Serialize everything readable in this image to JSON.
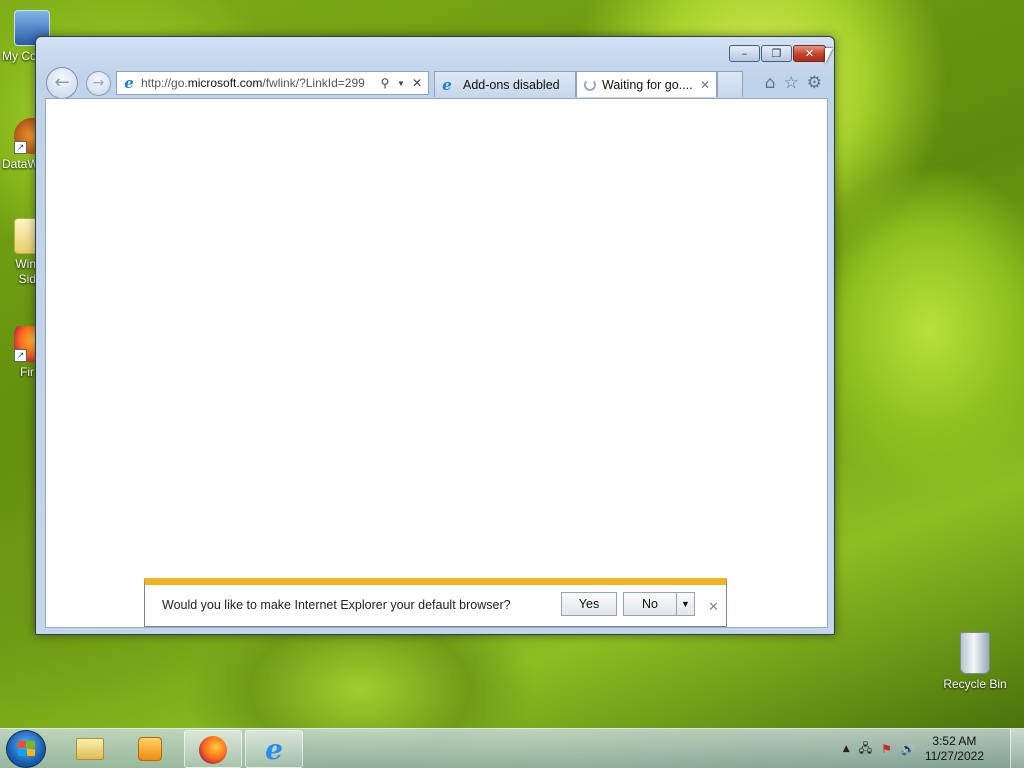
{
  "desktop": {
    "icons": [
      {
        "label": "My Co"
      },
      {
        "label": "DataW"
      },
      {
        "label": "Win\nSid"
      },
      {
        "label": "Fir"
      },
      {
        "label": "Recycle Bin"
      }
    ]
  },
  "browser": {
    "caption": {
      "minimize": "–",
      "restore": "❐",
      "close": "✕"
    },
    "address": {
      "prefix": "http://go.",
      "domain": "microsoft.com",
      "suffix": "/fwlink/?LinkId=299"
    },
    "tabs": [
      {
        "label": "Add-ons disabled",
        "active": false
      },
      {
        "label": "Waiting for go....",
        "active": true
      }
    ],
    "tab_close": "✕",
    "notification": {
      "message": "Would you like to make Internet Explorer your default browser?",
      "yes": "Yes",
      "no": "No",
      "dropdown": "▼",
      "close": "✕"
    }
  },
  "taskbar": {
    "time": "3:52 AM",
    "date": "11/27/2022",
    "tray_up": "▲"
  },
  "colors": {
    "accent_bar": "#f0b526",
    "close_red": "#c4402a"
  }
}
